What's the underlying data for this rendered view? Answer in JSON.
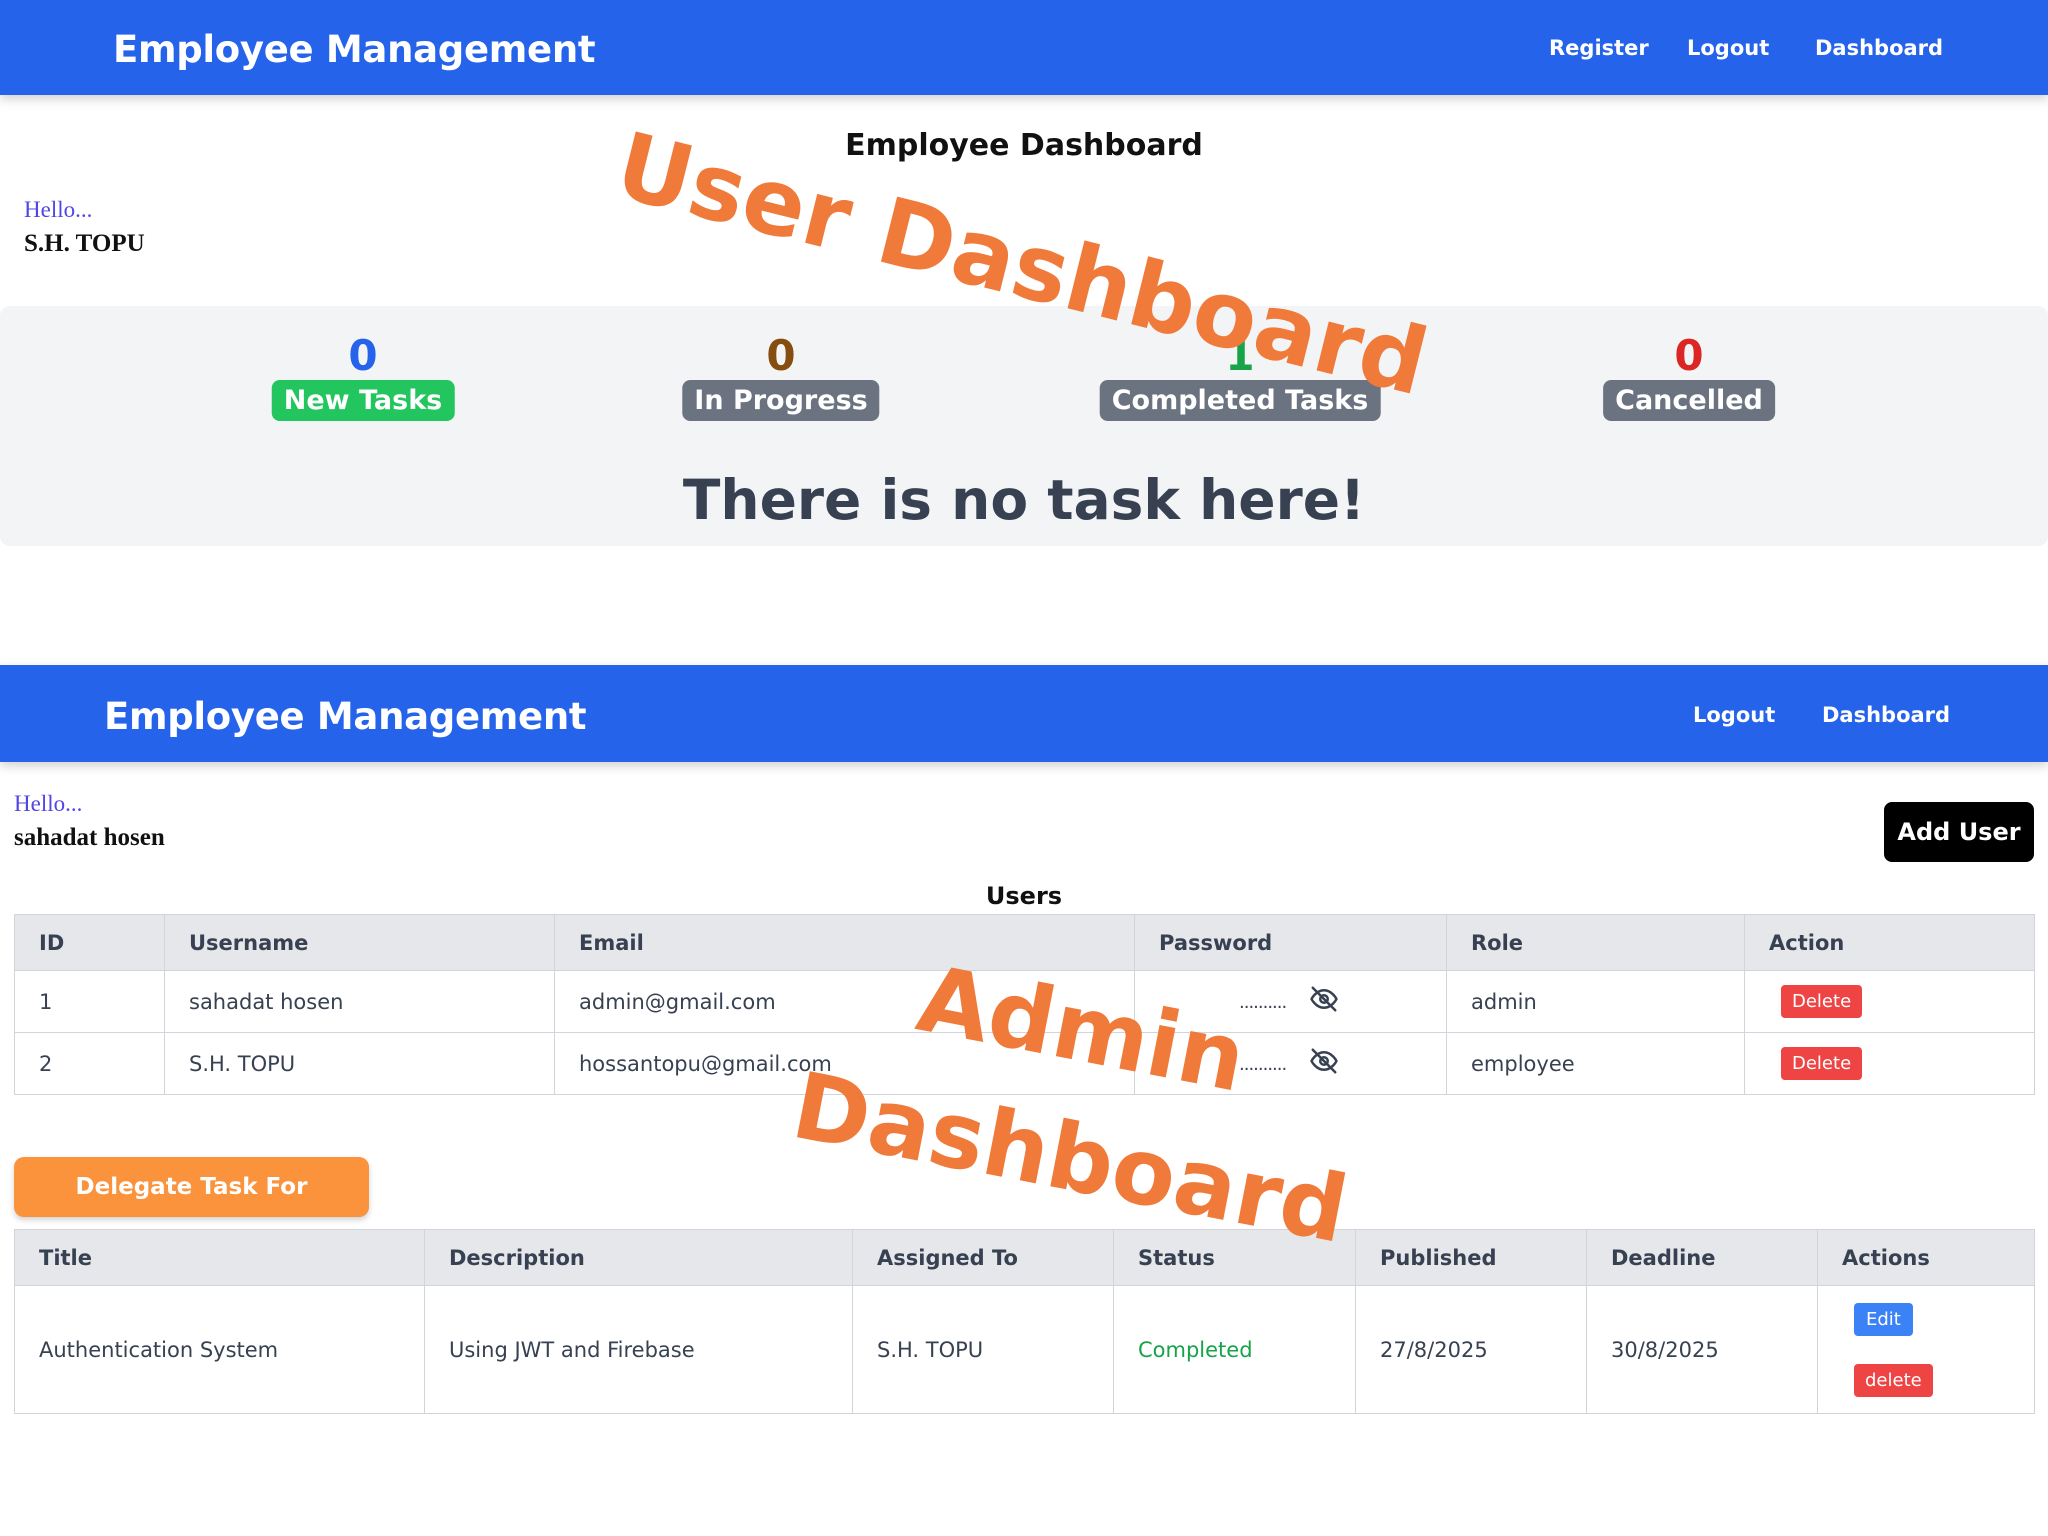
{
  "user_view": {
    "nav": {
      "brand": "Employee Management",
      "links": [
        "Register",
        "Logout",
        "Dashboard"
      ]
    },
    "page_title": "Employee Dashboard",
    "greeting": "Hello...",
    "user_name": "S.H. TOPU",
    "stats": [
      {
        "count": "0",
        "label": "New Tasks",
        "count_color": "#2563eb",
        "badge_color": "#22c55e"
      },
      {
        "count": "0",
        "label": "In Progress",
        "count_color": "#854d0e",
        "badge_color": "#6b7280"
      },
      {
        "count": "1",
        "label": "Completed Tasks",
        "count_color": "#16a34a",
        "badge_color": "#6b7280"
      },
      {
        "count": "0",
        "label": "Cancelled",
        "count_color": "#dc2626",
        "badge_color": "#6b7280"
      }
    ],
    "empty_message": "There is no task here!"
  },
  "admin_view": {
    "nav": {
      "brand": "Employee Management",
      "links": [
        "Logout",
        "Dashboard"
      ]
    },
    "greeting": "Hello...",
    "user_name": "sahadat hosen",
    "add_user_label": "Add User",
    "users_caption": "Users",
    "users_table": {
      "headers": [
        "ID",
        "Username",
        "Email",
        "Password",
        "Role",
        "Action"
      ],
      "rows": [
        {
          "id": "1",
          "username": "sahadat hosen",
          "email": "admin@gmail.com",
          "password": "..........",
          "role": "admin",
          "action": "Delete"
        },
        {
          "id": "2",
          "username": "S.H. TOPU",
          "email": "hossantopu@gmail.com",
          "password": "..........",
          "role": "employee",
          "action": "Delete"
        }
      ]
    },
    "delegate_label": "Delegate Task For Employee",
    "tasks_table": {
      "headers": [
        "Title",
        "Description",
        "Assigned To",
        "Status",
        "Published",
        "Deadline",
        "Actions"
      ],
      "rows": [
        {
          "title": "Authentication System",
          "description": "Using JWT and Firebase",
          "assigned_to": "S.H. TOPU",
          "status": "Completed",
          "published": "27/8/2025",
          "deadline": "30/8/2025",
          "edit": "Edit",
          "delete": "delete"
        }
      ]
    }
  },
  "overlay_labels": {
    "user": "User Dashboard",
    "admin_line1": "Admin",
    "admin_line2": "Dashboard"
  },
  "colors": {
    "nav_bg": "#2563eb",
    "overlay": "#f07a3a",
    "delegate_button": "#fb923c",
    "delete_button": "#ef4444",
    "edit_button": "#3b82f6"
  }
}
